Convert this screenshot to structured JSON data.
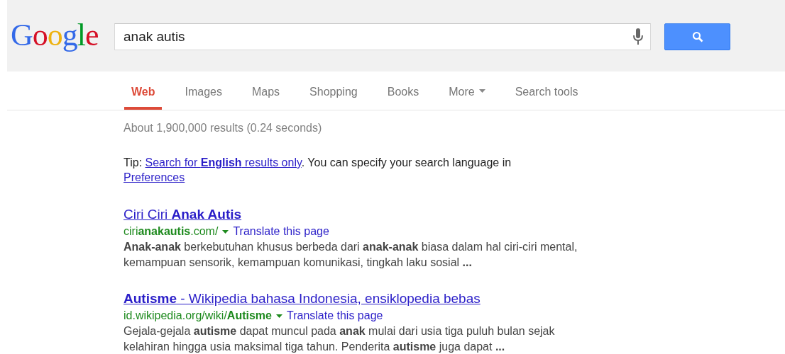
{
  "logo": "Google",
  "search": {
    "value": "anak autis"
  },
  "tabs": [
    {
      "label": "Web",
      "selected": true,
      "kind": "tab"
    },
    {
      "label": "Images",
      "selected": false,
      "kind": "tab"
    },
    {
      "label": "Maps",
      "selected": false,
      "kind": "tab"
    },
    {
      "label": "Shopping",
      "selected": false,
      "kind": "tab"
    },
    {
      "label": "Books",
      "selected": false,
      "kind": "tab"
    },
    {
      "label": "More",
      "selected": false,
      "kind": "dropdown"
    },
    {
      "label": "Search tools",
      "selected": false,
      "kind": "tab"
    }
  ],
  "result_stats": "About 1,900,000 results (0.24 seconds)",
  "tip": {
    "prefix": "Tip: ",
    "link": "Search for **English** results only",
    "middle": ". You can specify your search language in",
    "preferences_link": "Preferences"
  },
  "results": [
    {
      "title": "Ciri Ciri **Anak Autis**",
      "url": "ciri**anakautis**.com/",
      "translate": "Translate this page",
      "snippet": "**Anak-anak** berkebutuhan khusus berbeda dari **anak-anak** biasa dalam hal ciri-ciri mental, kemampuan sensorik, kemampuan komunikasi, tingkah laku sosial **...**"
    },
    {
      "title": "**Autisme** - Wikipedia bahasa Indonesia, ensiklopedia bebas",
      "url": "id.wikipedia.org/wiki/**Autisme**",
      "translate": "Translate this page",
      "snippet": "Gejala-gejala **autisme** dapat muncul pada **anak** mulai dari usia tiga puluh bulan sejak kelahiran hingga usia maksimal tiga tahun. Penderita **autisme** juga dapat **...**"
    }
  ]
}
